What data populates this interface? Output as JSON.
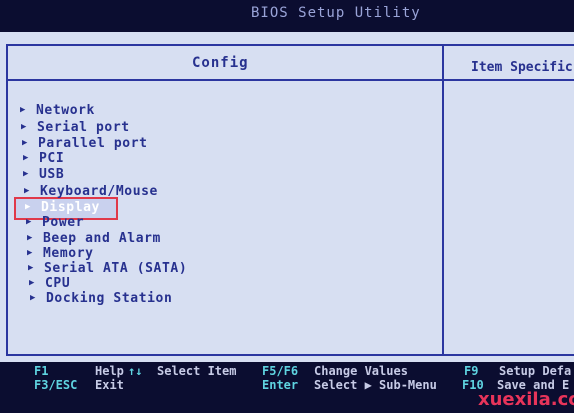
{
  "app_title": "BIOS Setup Utility",
  "header": {
    "tab_config": "Config",
    "item_specific": "Item Specific"
  },
  "menu": [
    {
      "label": "Network"
    },
    {
      "label": "Serial port"
    },
    {
      "label": "Parallel port"
    },
    {
      "label": "PCI"
    },
    {
      "label": "USB"
    },
    {
      "label": "Keyboard/Mouse"
    },
    {
      "label": "Display",
      "selected": true
    },
    {
      "label": "Power"
    },
    {
      "label": "Beep and Alarm"
    },
    {
      "label": "Memory"
    },
    {
      "label": "Serial ATA (SATA)"
    },
    {
      "label": "CPU"
    },
    {
      "label": "Docking Station"
    }
  ],
  "footer": {
    "row1": [
      {
        "key": "F1",
        "desc": "Help"
      },
      {
        "key": "↑↓",
        "desc": "Select Item"
      },
      {
        "key": "F5/F6",
        "desc": "Change Values"
      },
      {
        "key": "F9",
        "desc": "Setup Defa"
      }
    ],
    "row2": [
      {
        "key": "F3/ESC",
        "desc": "Exit"
      },
      {
        "key": "Enter",
        "desc": "Select ▶ Sub-Menu"
      },
      {
        "key": "F10",
        "desc": "Save and E"
      }
    ]
  },
  "watermark": "xuexila.com"
}
